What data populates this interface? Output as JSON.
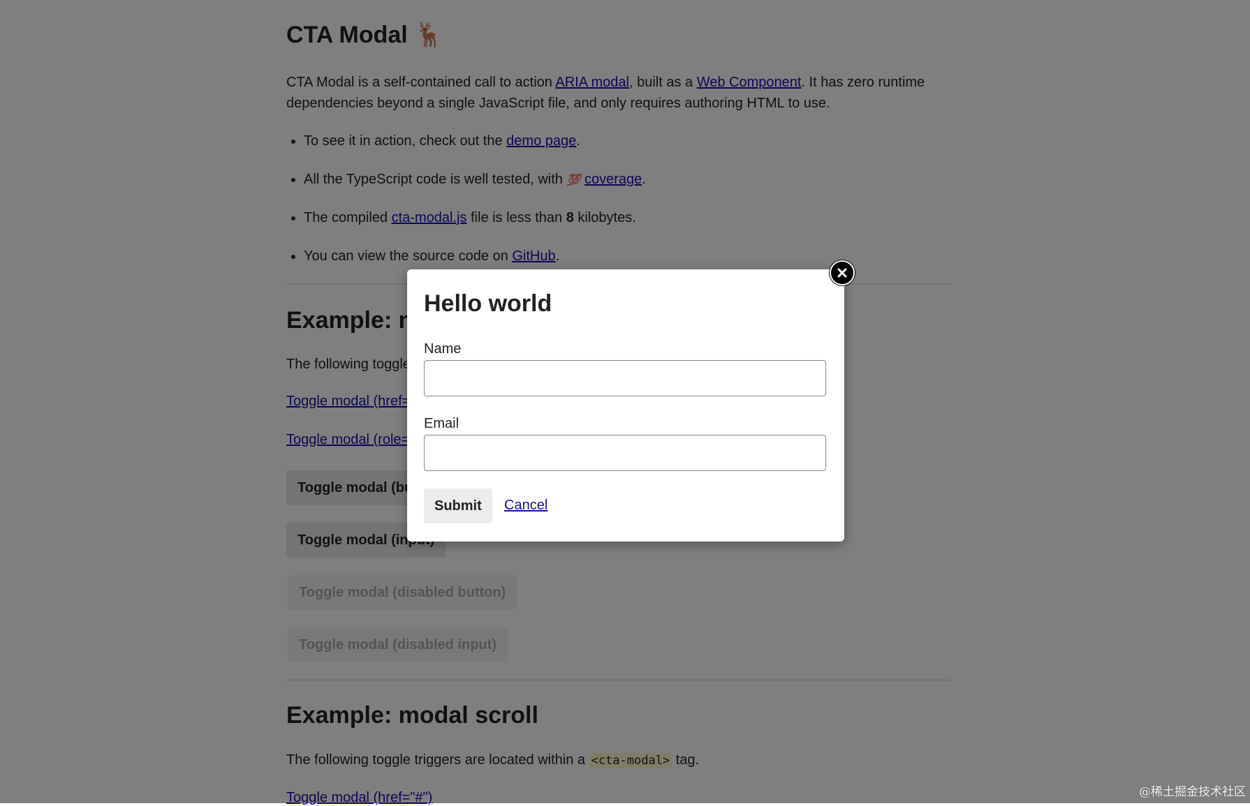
{
  "page": {
    "title": "CTA Modal",
    "title_emoji": "🦌",
    "intro": {
      "text_1": "CTA Modal is a self-contained call to action ",
      "link_aria": "ARIA modal",
      "text_2": ", built as a ",
      "link_wc": "Web Component",
      "text_3": ". It has zero runtime dependencies beyond a single JavaScript file, and only requires authoring HTML to use."
    },
    "features": {
      "item1_text": "To see it in action, check out the ",
      "item1_link": "demo page",
      "item1_end": ".",
      "item2_text": "All the TypeScript code is well tested, with ",
      "item2_emoji": "💯",
      "item2_link": "coverage",
      "item2_end": ".",
      "item3_text": "The compiled ",
      "item3_link": "cta-modal.js",
      "item3_mid": " file is less than ",
      "item3_bold": "8",
      "item3_end": " kilobytes.",
      "item4_text": "You can view the source code on ",
      "item4_link": "GitHub",
      "item4_end": "."
    },
    "section1": {
      "heading": "Example: m",
      "desc": "The following toggle",
      "link_href": "Toggle modal (href=",
      "link_role": "Toggle modal (role=",
      "btn_button": "Toggle modal (bu",
      "btn_input": "Toggle modal (input)",
      "btn_disabled_button": "Toggle modal (disabled button)",
      "btn_disabled_input": "Toggle modal (disabled input)"
    },
    "section2": {
      "heading": "Example: modal scroll",
      "desc_1": "The following toggle triggers are located within a ",
      "desc_code": "<cta-modal>",
      "desc_2": " tag.",
      "link_href": "Toggle modal (href=\"#\")"
    }
  },
  "modal": {
    "title": "Hello world",
    "name_label": "Name",
    "name_value": "",
    "email_label": "Email",
    "email_value": "",
    "submit_label": "Submit",
    "cancel_label": "Cancel",
    "close_icon": "close-icon"
  },
  "watermark": "@稀土掘金技术社区",
  "colors": {
    "link": "#1a0dab",
    "overlay": "rgba(0,0,0,0.5)",
    "close_button": "#000000",
    "code_bg": "#fffbcc"
  }
}
